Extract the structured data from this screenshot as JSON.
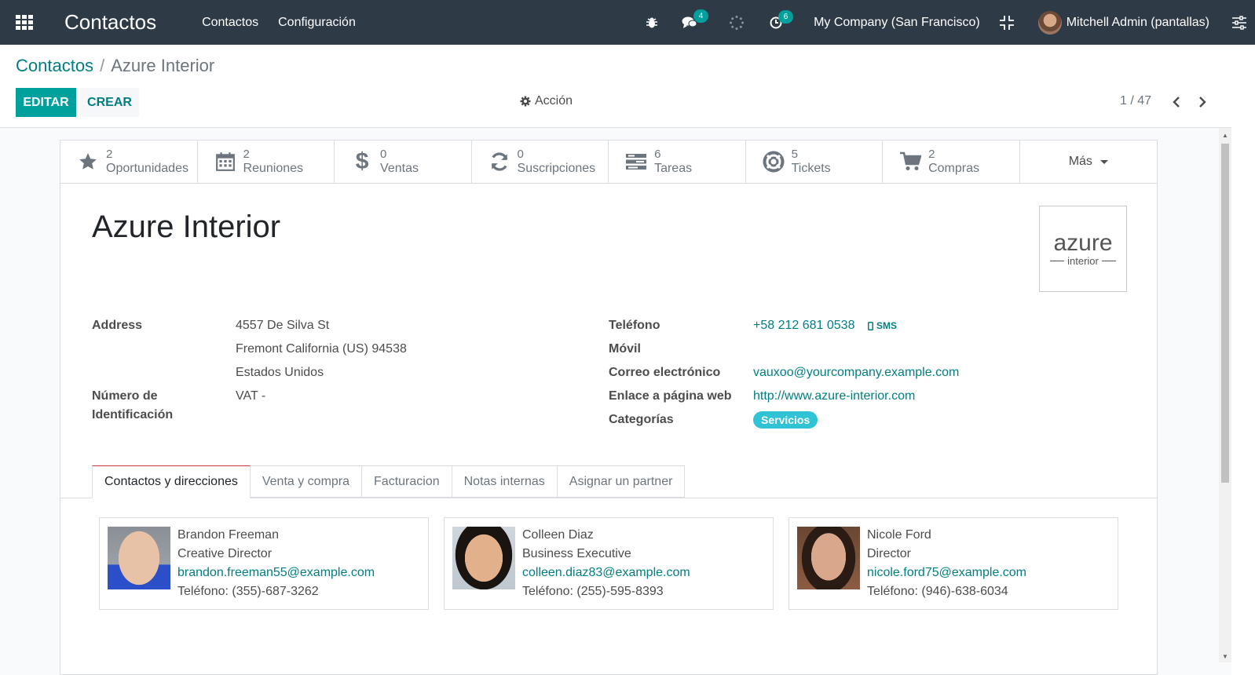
{
  "navbar": {
    "app_title": "Contactos",
    "menu": [
      "Contactos",
      "Configuración"
    ],
    "messages_count": "4",
    "activities_count": "6",
    "company": "My Company (San Francisco)",
    "user": "Mitchell Admin (pantallas)"
  },
  "control_panel": {
    "breadcrumb_parent": "Contactos",
    "breadcrumb_sep": "/",
    "breadcrumb_current": "Azure Interior",
    "edit_label": "EDITAR",
    "create_label": "CREAR",
    "action_label": "Acción",
    "pager": "1 / 47"
  },
  "smart_buttons": [
    {
      "icon": "star-icon",
      "count": "2",
      "label": "Oportunidades"
    },
    {
      "icon": "calendar-icon",
      "count": "2",
      "label": "Reuniones"
    },
    {
      "icon": "dollar-icon",
      "count": "0",
      "label": "Ventas"
    },
    {
      "icon": "refresh-icon",
      "count": "0",
      "label": "Suscripciones"
    },
    {
      "icon": "tasks-icon",
      "count": "6",
      "label": "Tareas"
    },
    {
      "icon": "lifebuoy-icon",
      "count": "5",
      "label": "Tickets"
    },
    {
      "icon": "cart-icon",
      "count": "2",
      "label": "Compras"
    }
  ],
  "more_label": "Más",
  "partner": {
    "name": "Azure Interior",
    "logo_main": "azure",
    "logo_sub": "interior",
    "address_label": "Address",
    "street": "4557 De Silva St",
    "city_line": "Fremont  California (US)  94538",
    "country": "Estados Unidos",
    "vat_label_1": "Número de",
    "vat_label_2": "Identificación",
    "vat_value": "VAT -",
    "phone_label": "Teléfono",
    "phone": "+58 212 681 0538",
    "sms_label": "SMS",
    "mobile_label": "Móvil",
    "email_label": "Correo electrónico",
    "email": "vauxoo@yourcompany.example.com",
    "website_label": "Enlace a página web",
    "website": "http://www.azure-interior.com",
    "categories_label": "Categorías",
    "category_tag": "Servicios",
    "tag_color": "#30c3d5"
  },
  "tabs": [
    "Contactos y direcciones",
    "Venta y compra",
    "Facturacion",
    "Notas internas",
    "Asignar un partner"
  ],
  "contacts": [
    {
      "name": "Brandon Freeman",
      "title": "Creative Director",
      "email": "brandon.freeman55@example.com",
      "phone": "Teléfono: (355)-687-3262"
    },
    {
      "name": "Colleen Diaz",
      "title": "Business Executive",
      "email": "colleen.diaz83@example.com",
      "phone": "Teléfono: (255)-595-8393"
    },
    {
      "name": "Nicole Ford",
      "title": "Director",
      "email": "nicole.ford75@example.com",
      "phone": "Teléfono: (946)-638-6034"
    }
  ],
  "colors": {
    "navbar": "#2e3a46",
    "primary": "#00a09d",
    "link": "#017e84"
  }
}
